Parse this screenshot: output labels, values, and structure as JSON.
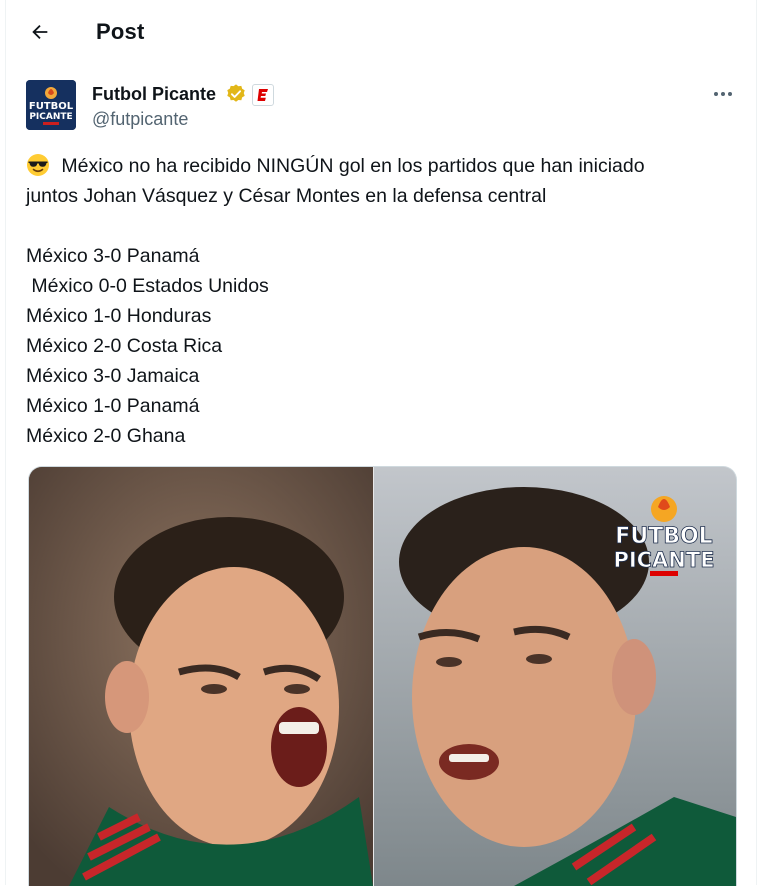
{
  "header": {
    "title": "Post"
  },
  "post": {
    "author_name": "Futbol Picante",
    "handle": "@futpicante",
    "affiliate_badge": "E",
    "avatar_text": [
      "FUTBOL",
      "PICANTE"
    ],
    "text": " México no ha recibido NINGÚN gol en los partidos que han iniciado\njuntos Johan Vásquez y César Montes en la defensa central\n\nMéxico 3-0 Panamá\n México 0-0 Estados Unidos\nMéxico 1-0 Honduras\nMéxico 2-0 Costa Rica\nMéxico 3-0 Jamaica\nMéxico 1-0 Panamá\nMéxico 2-0 Ghana",
    "emoji": "smiling-face-with-sunglasses"
  },
  "media": {
    "overlay_logo_lines": [
      "FUTBOL",
      "PICANTE"
    ]
  },
  "colors": {
    "verified_gold": "#e2b719",
    "espn_red": "#d00",
    "secondary_text": "#536471"
  }
}
